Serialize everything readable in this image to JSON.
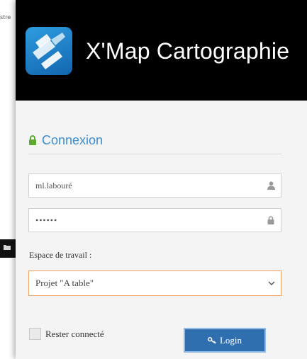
{
  "background": {
    "partial_text": "stre"
  },
  "header": {
    "title": "X'Map Cartographie",
    "logo_icon": "xmap-logo-icon"
  },
  "login_form": {
    "heading": "Connexion",
    "username": "ml.labouré",
    "password_masked": "••••••",
    "workspace_label": "Espace de travail :",
    "workspace_value": "Projet \"A table\"",
    "remember_label": "Rester connecté",
    "remember_checked": false,
    "login_button": "Login"
  },
  "icons": {
    "heading": "lock-icon",
    "username": "user-icon",
    "password": "lock-icon",
    "select": "chevron-down-icon",
    "login": "key-icon"
  },
  "colors": {
    "accent": "#3b8fd1",
    "button": "#2f6fb0",
    "lock_green": "#5fa832",
    "select_border": "#f0a060",
    "header_bg": "#000000"
  }
}
